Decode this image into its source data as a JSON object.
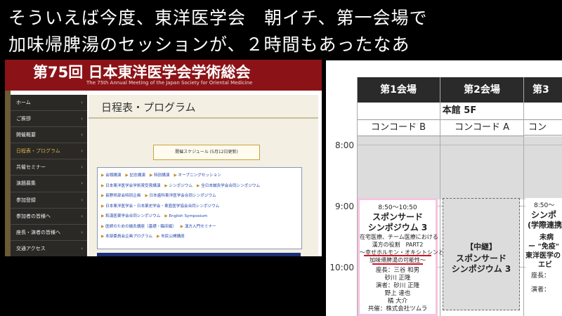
{
  "caption": {
    "line1": "そういえば今度、東洋医学会　朝イチ、第一会場で",
    "line2": "加味帰脾湯のセッションが、２時間もあったなあ"
  },
  "site": {
    "banner_title": "第75回 日本東洋医学会学術総会",
    "banner_subtitle": "The 75th Annual Meeting of the Japan Society for Oriental Medicine",
    "nav": [
      {
        "label": "ホーム",
        "active": false
      },
      {
        "label": "ご挨拶",
        "active": false
      },
      {
        "label": "開催概要",
        "active": false
      },
      {
        "label": "日程表・プログラム",
        "active": true
      },
      {
        "label": "共催セミナー",
        "active": false
      },
      {
        "label": "演題募集",
        "active": false
      },
      {
        "label": "参加登録",
        "active": false
      },
      {
        "label": "参加者の皆様へ",
        "active": false
      },
      {
        "label": "座長・演者の皆様へ",
        "active": false
      },
      {
        "label": "交通アクセス",
        "active": false
      }
    ],
    "page_title": "日程表・プログラム",
    "schedule_button": "開催スケジュール (5月12日更新)",
    "links": [
      [
        "会頭講演",
        "記念講演",
        "特別講演",
        "オープニングセッション"
      ],
      [
        "日本東洋医学会学術賞受賞講演",
        "シンポジウム",
        "全日本鍼灸学会合同シンポジウム"
      ],
      [
        "長野県部会特別企画",
        "日本歯科東洋医学会合同シンポジウム"
      ],
      [
        "日本東洋医学会・日本薬史学会・東亜医学協会合同シンポジウム"
      ],
      [
        "和漢医薬学会合同シンポジウム",
        "English Symposium"
      ],
      [
        "医師のための鍼灸講座（基礎・臨床編）",
        "漢方入門セミナー"
      ],
      [
        "本部委員会企画プログラム",
        "市民公開講座"
      ]
    ]
  },
  "timetable": {
    "columns": [
      "第1会場",
      "第2会場",
      "第3"
    ],
    "hall": "本館 5F",
    "rooms": [
      "コンコード B",
      "コンコード A",
      "コン"
    ],
    "times": [
      "8:00",
      "9:00",
      "10:00"
    ],
    "session1": {
      "time": "8:50〜10:50",
      "title1": "スポンサード",
      "title2": "シンポジウム 3",
      "desc1": "在宅医療、チーム医療における",
      "desc2": "漢方の役割　PART2",
      "desc3": "〜幸せホルモン・オキシトシンと",
      "desc4": "加味帰脾湯の可能性〜",
      "chair1": "座長：三谷 和男",
      "chair2": "砂川 正隆",
      "speaker1": "演者：砂川 正隆",
      "speaker2": "野上 達也",
      "speaker3": "橘 大介",
      "sponsor": "共催：株式会社ツムラ"
    },
    "session2": {
      "relay": "【中継】",
      "title1": "スポンサード",
      "title2": "シンポジウム 3"
    },
    "session3": {
      "time": "8:50〜",
      "title1": "シンポ",
      "title2": "(学際連携シ",
      "desc1": "未病",
      "desc2": "ー \"免疫\"",
      "desc3": "東洋医学の",
      "desc4": "エビ",
      "chair": "座長：",
      "speaker": "演者："
    }
  }
}
